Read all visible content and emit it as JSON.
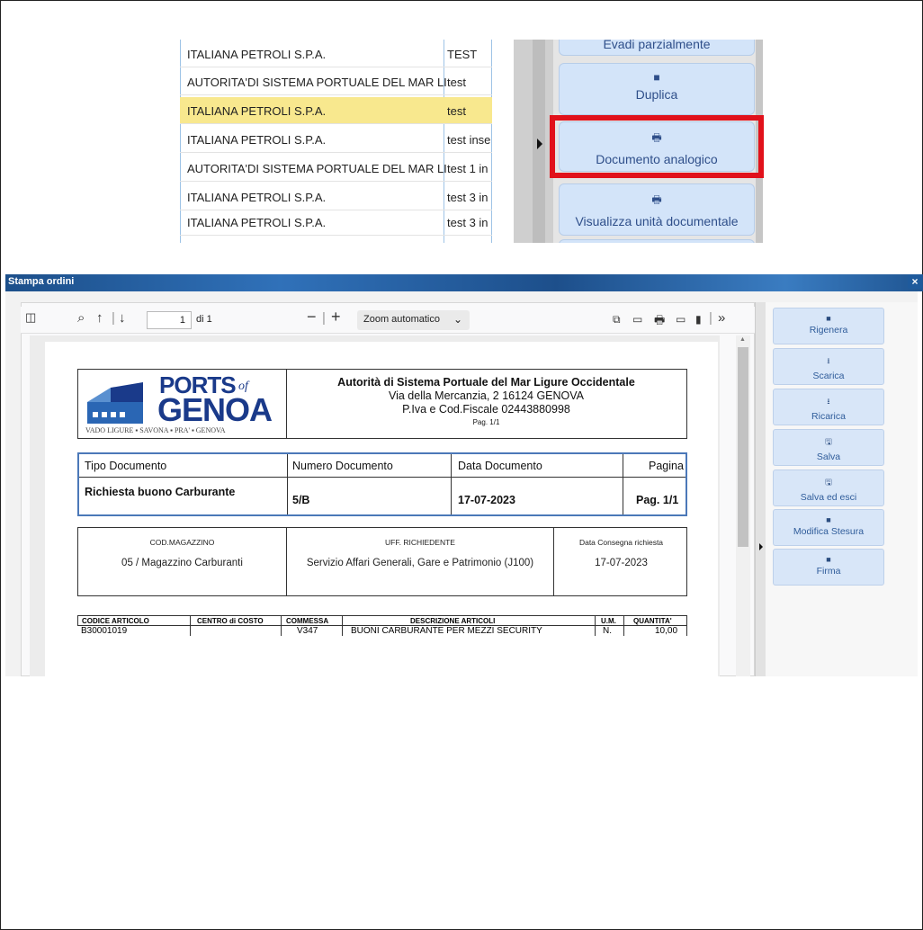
{
  "top_list": {
    "rows": [
      {
        "name": "ITALIANA PETROLI S.P.A.",
        "desc": "TEST",
        "selected": false
      },
      {
        "name": "AUTORITA'DI SISTEMA PORTUALE DEL MAR LI",
        "desc": "test",
        "selected": false
      },
      {
        "name": "ITALIANA PETROLI S.P.A.",
        "desc": "test",
        "selected": true
      },
      {
        "name": "ITALIANA PETROLI S.P.A.",
        "desc": "test inse",
        "selected": false
      },
      {
        "name": "AUTORITA'DI SISTEMA PORTUALE DEL MAR LI",
        "desc": "test 1 in",
        "selected": false
      },
      {
        "name": "ITALIANA PETROLI S.P.A.",
        "desc": "test 3 in",
        "selected": false
      },
      {
        "name": "ITALIANA PETROLI S.P.A.",
        "desc": "test 3 in",
        "selected": false
      }
    ]
  },
  "top_actions": {
    "evadi": "Evadi parzialmente",
    "duplica": "Duplica",
    "documento_analogico": "Documento analogico",
    "visualizza": "Visualizza unità documentale"
  },
  "dialog": {
    "title": "Stampa ordini",
    "close": "×"
  },
  "pdf_toolbar": {
    "page_value": "1",
    "page_of": "di 1",
    "zoom": "Zoom automatico"
  },
  "document": {
    "logo": {
      "ports": "PORTS",
      "of": "of",
      "genoa": "GENOA",
      "tagline": "VADO LIGURE ▪ SAVONA ▪ PRA' ▪ GENOVA"
    },
    "org_name": "Autorità di Sistema Portuale del Mar Ligure Occidentale",
    "address": "Via della Mercanzia, 2 16124 GENOVA",
    "piva": "P.Iva e Cod.Fiscale 02443880998",
    "page_small": "Pag. 1/1",
    "tipo": {
      "h_tipo": "Tipo Documento",
      "h_numero": "Numero Documento",
      "h_data": "Data Documento",
      "h_pagina": "Pagina",
      "v_tipo": "Richiesta buono  Carburante",
      "v_numero": "5/B",
      "v_data": "17-07-2023",
      "v_pagina": "Pag. 1/1"
    },
    "magazzino": {
      "l_cod": "COD.MAGAZZINO",
      "v_cod": "05 / Magazzino Carburanti",
      "l_uff": "UFF. RICHIEDENTE",
      "v_uff": "Servizio Affari Generali, Gare e Patrimonio (J100)",
      "l_data": "Data Consegna richiesta",
      "v_data": "17-07-2023"
    },
    "items": {
      "headers": [
        "CODICE ARTICOLO",
        "CENTRO di COSTO",
        "COMMESSA",
        "DESCRIZIONE ARTICOLI",
        "U.M.",
        "QUANTITA'"
      ],
      "rows": [
        [
          "B30001019",
          "",
          "V347",
          "BUONI CARBURANTE PER MEZZI SECURITY",
          "N.",
          "10,00"
        ]
      ]
    }
  },
  "side_actions": {
    "rigenera": "Rigenera",
    "scarica": "Scarica",
    "ricarica": "Ricarica",
    "salva": "Salva",
    "salva_esci": "Salva ed esci",
    "modifica": "Modifica Stesura",
    "firma": "Firma"
  }
}
